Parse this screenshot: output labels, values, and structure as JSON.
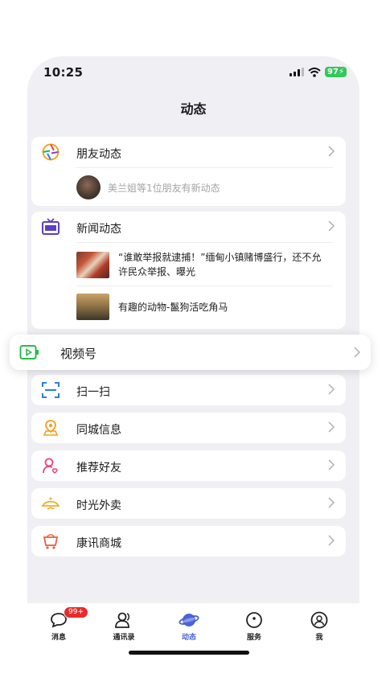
{
  "status": {
    "time": "10:25",
    "battery": "97"
  },
  "page": {
    "title": "动态"
  },
  "friends": {
    "label": "朋友动态",
    "sub": "美兰姐等1位朋友有新动态"
  },
  "news": {
    "label": "新闻动态",
    "items": [
      {
        "text": "“谁敢举报就逮捕！”缅甸小镇赌博盛行，还不允许民众举报、曝光"
      },
      {
        "text": "有趣的动物-鬣狗活吃角马"
      }
    ]
  },
  "video": {
    "label": "视频号"
  },
  "menu": [
    {
      "label": "扫一扫",
      "icon": "scan-icon"
    },
    {
      "label": "同城信息",
      "icon": "location-icon"
    },
    {
      "label": "推荐好友",
      "icon": "friend-recommend-icon"
    },
    {
      "label": "时光外卖",
      "icon": "takeout-icon"
    },
    {
      "label": "康讯商城",
      "icon": "shop-cart-icon"
    }
  ],
  "tabs": [
    {
      "label": "消息",
      "icon": "chat-bubble-icon",
      "badge": "99+"
    },
    {
      "label": "通讯录",
      "icon": "contacts-icon"
    },
    {
      "label": "动态",
      "icon": "planet-icon",
      "active": true
    },
    {
      "label": "服务",
      "icon": "service-icon"
    },
    {
      "label": "我",
      "icon": "profile-icon"
    }
  ],
  "colors": {
    "accent": "#4a63d8",
    "badge": "#e52c2c",
    "battery": "#34c759"
  }
}
